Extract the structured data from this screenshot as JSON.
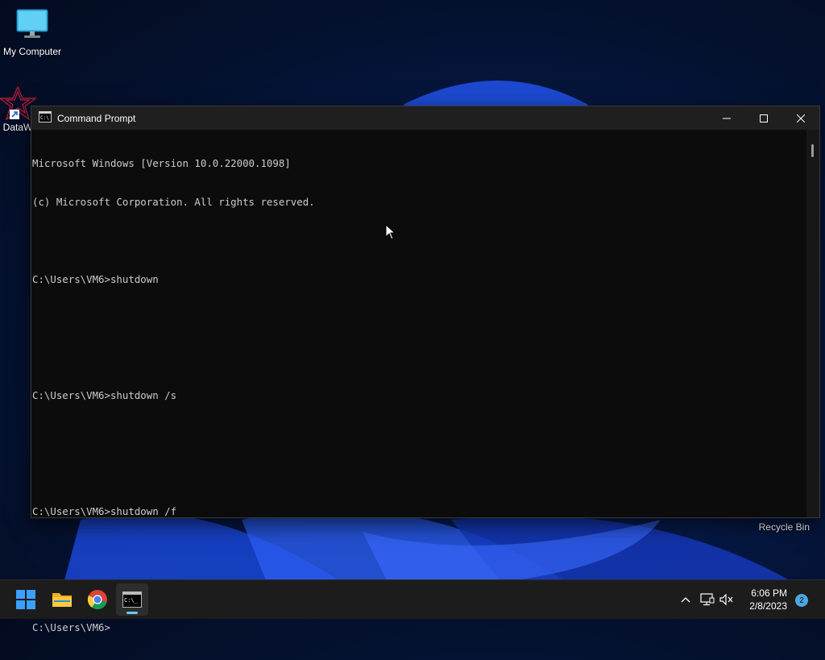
{
  "desktop": {
    "icons": [
      {
        "label": "My Computer",
        "icon": "monitor-icon"
      },
      {
        "label": "DataW",
        "icon": "datawrapper-shortcut-icon"
      }
    ],
    "recycle_bin_label": "Recycle Bin"
  },
  "window": {
    "title": "Command Prompt",
    "icon": "cmd-icon",
    "controls": {
      "minimize": "minimize-icon",
      "maximize": "maximize-icon",
      "close": "close-icon"
    },
    "console_lines": [
      "Microsoft Windows [Version 10.0.22000.1098]",
      "(c) Microsoft Corporation. All rights reserved.",
      "",
      "C:\\Users\\VM6>shutdown",
      "",
      "",
      "C:\\Users\\VM6>shutdown /s",
      "",
      "",
      "C:\\Users\\VM6>shutdown /f",
      "",
      "",
      "C:\\Users\\VM6>"
    ]
  },
  "taskbar": {
    "apps": [
      {
        "name": "start",
        "icon": "windows-logo-icon"
      },
      {
        "name": "file-explorer",
        "icon": "folder-icon"
      },
      {
        "name": "chrome",
        "icon": "chrome-icon"
      },
      {
        "name": "command-prompt",
        "icon": "terminal-icon",
        "active": true
      }
    ],
    "tray": {
      "icons": [
        "chevron-up-icon",
        "network-icon",
        "volume-muted-icon"
      ],
      "time": "6:06 PM",
      "date": "2/8/2023",
      "notification_count": "2"
    }
  },
  "colors": {
    "console_bg": "#0c0c0c",
    "console_text": "#cccccc",
    "taskbar_bg": "#1c1c1c",
    "accent": "#4aa8e0"
  }
}
